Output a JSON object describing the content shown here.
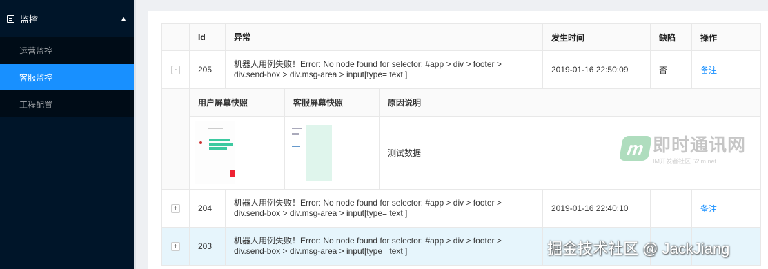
{
  "sidebar": {
    "section_title": "监控",
    "items": [
      {
        "label": "运营监控",
        "active": false
      },
      {
        "label": "客服监控",
        "active": true
      },
      {
        "label": "工程配置",
        "active": false
      }
    ]
  },
  "table": {
    "columns": [
      "Id",
      "异常",
      "发生时间",
      "缺陷",
      "操作"
    ],
    "rows": [
      {
        "expand": "-",
        "id": "205",
        "error": "机器人用例失败！Error: No node found for selector: #app > div > footer > div.send-box > div.msg-area > input[type= text ]",
        "time": "2019-01-16 22:50:09",
        "defect": "否",
        "action": "备注"
      },
      {
        "expand": "+",
        "id": "204",
        "error": "机器人用例失败！Error: No node found for selector: #app > div > footer > div.send-box > div.msg-area > input[type= text ]",
        "time": "2019-01-16 22:40:10",
        "defect": "",
        "action": "备注"
      },
      {
        "expand": "+",
        "id": "203",
        "error": "机器人用例失败！Error: No node found for selector: #app > div > footer > div.send-box > div.msg-area > input[type= text ]",
        "time": "",
        "defect": "",
        "action": ""
      }
    ],
    "expanded": {
      "columns": [
        "用户屏幕快照",
        "客服屏幕快照",
        "原因说明"
      ],
      "reason": "测试数据"
    }
  },
  "watermarks": {
    "logo_text": "即时通讯网",
    "logo_sub": "IM开发者社区 52im.net",
    "bottom": "掘金技术社区 @ JackJiang"
  },
  "colors": {
    "sidebar_bg": "#001529",
    "active": "#1890ff",
    "link": "#1890ff",
    "highlight_row": "#e6f5fc"
  }
}
